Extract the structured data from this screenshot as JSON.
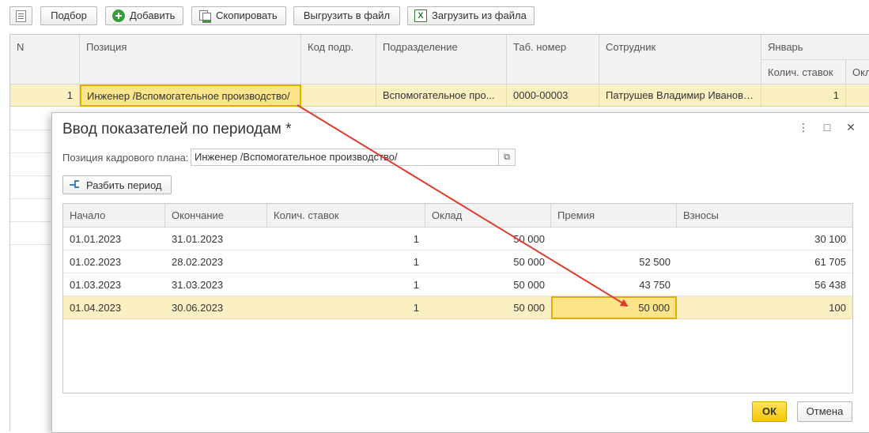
{
  "toolbar": {
    "select_label": "Подбор",
    "add_label": "Добавить",
    "copy_label": "Скопировать",
    "export_label": "Выгрузить в файл",
    "import_label": "Загрузить из файла",
    "import_icon_text": "X"
  },
  "main_table": {
    "headers": {
      "n": "N",
      "position": "Позиция",
      "dept_code": "Код подр.",
      "department": "Подразделение",
      "tab_number": "Таб. номер",
      "employee": "Сотрудник",
      "january": "Январь",
      "rate_count": "Колич. ставок",
      "salary_cut": "Окл"
    },
    "row": {
      "n": "1",
      "position": "Инженер /Вспомогательное производство/",
      "dept_code": "",
      "department": "Вспомогательное про...",
      "tab_number": "0000-00003",
      "employee": "Патрушев Владимир Иванович",
      "rate_count": "1"
    }
  },
  "dialog": {
    "title": "Ввод показателей по периодам *",
    "menu_icon": "⋮",
    "maximize_icon": "□",
    "close_icon": "✕",
    "field_label": "Позиция кадрового плана:",
    "field_value": "Инженер /Вспомогательное производство/",
    "field_button_icon": "⧉",
    "split_button": "Разбить период",
    "table": {
      "headers": {
        "start": "Начало",
        "end": "Окончание",
        "rates": "Колич. ставок",
        "salary": "Оклад",
        "bonus": "Премия",
        "contributions": "Взносы"
      },
      "rows": [
        {
          "start": "01.01.2023",
          "end": "31.01.2023",
          "rates": "1",
          "salary": "50 000",
          "bonus": "",
          "contributions": "30 100"
        },
        {
          "start": "01.02.2023",
          "end": "28.02.2023",
          "rates": "1",
          "salary": "50 000",
          "bonus": "52 500",
          "contributions": "61 705"
        },
        {
          "start": "01.03.2023",
          "end": "31.03.2023",
          "rates": "1",
          "salary": "50 000",
          "bonus": "43 750",
          "contributions": "56 438"
        },
        {
          "start": "01.04.2023",
          "end": "30.06.2023",
          "rates": "1",
          "salary": "50 000",
          "bonus": "50 000",
          "contributions": "100"
        }
      ]
    },
    "ok_label": "ОК",
    "cancel_label": "Отмена"
  },
  "annotation": {
    "arrow_color": "#e03a2a"
  },
  "colors": {
    "selection": "#fbf0c2",
    "selected_cell_border": "#e0b000",
    "ok_button": "#f5d000"
  }
}
